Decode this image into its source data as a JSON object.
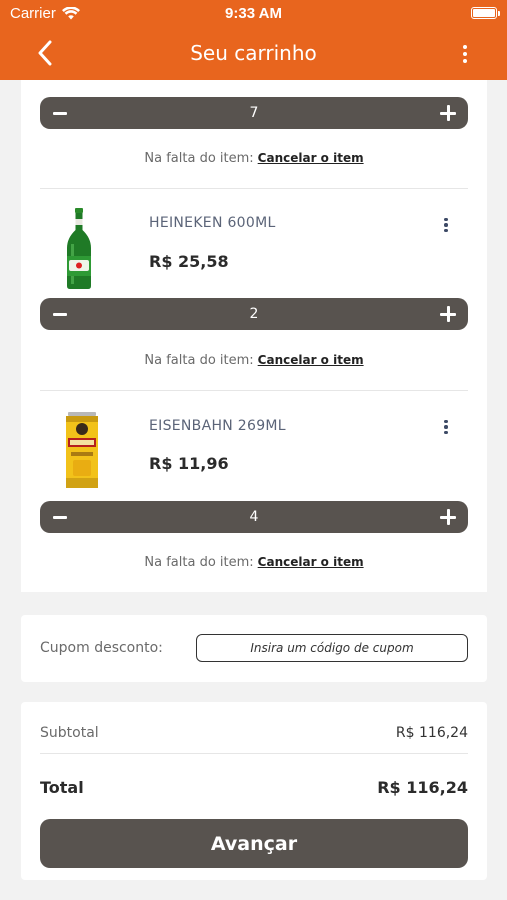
{
  "status_bar": {
    "carrier": "Carrier",
    "time": "9:33 AM"
  },
  "header": {
    "title": "Seu carrinho"
  },
  "cart": {
    "fallback_label": "Na falta do item:",
    "cancel_label": "Cancelar o item",
    "items": [
      {
        "quantity": "7"
      },
      {
        "name": "HEINEKEN 600ML",
        "price": "R$ 25,58",
        "quantity": "2",
        "image": "green-beer-bottle"
      },
      {
        "name": "EISENBAHN 269ML",
        "price": "R$ 11,96",
        "quantity": "4",
        "image": "yellow-beer-can"
      }
    ]
  },
  "coupon": {
    "label": "Cupom desconto:",
    "placeholder": "Insira um código de cupom"
  },
  "summary": {
    "subtotal_label": "Subtotal",
    "subtotal_value": "R$ 116,24",
    "total_label": "Total",
    "total_value": "R$ 116,24",
    "advance_label": "Avançar"
  },
  "colors": {
    "brand": "#e8651e",
    "button": "#58534f"
  }
}
